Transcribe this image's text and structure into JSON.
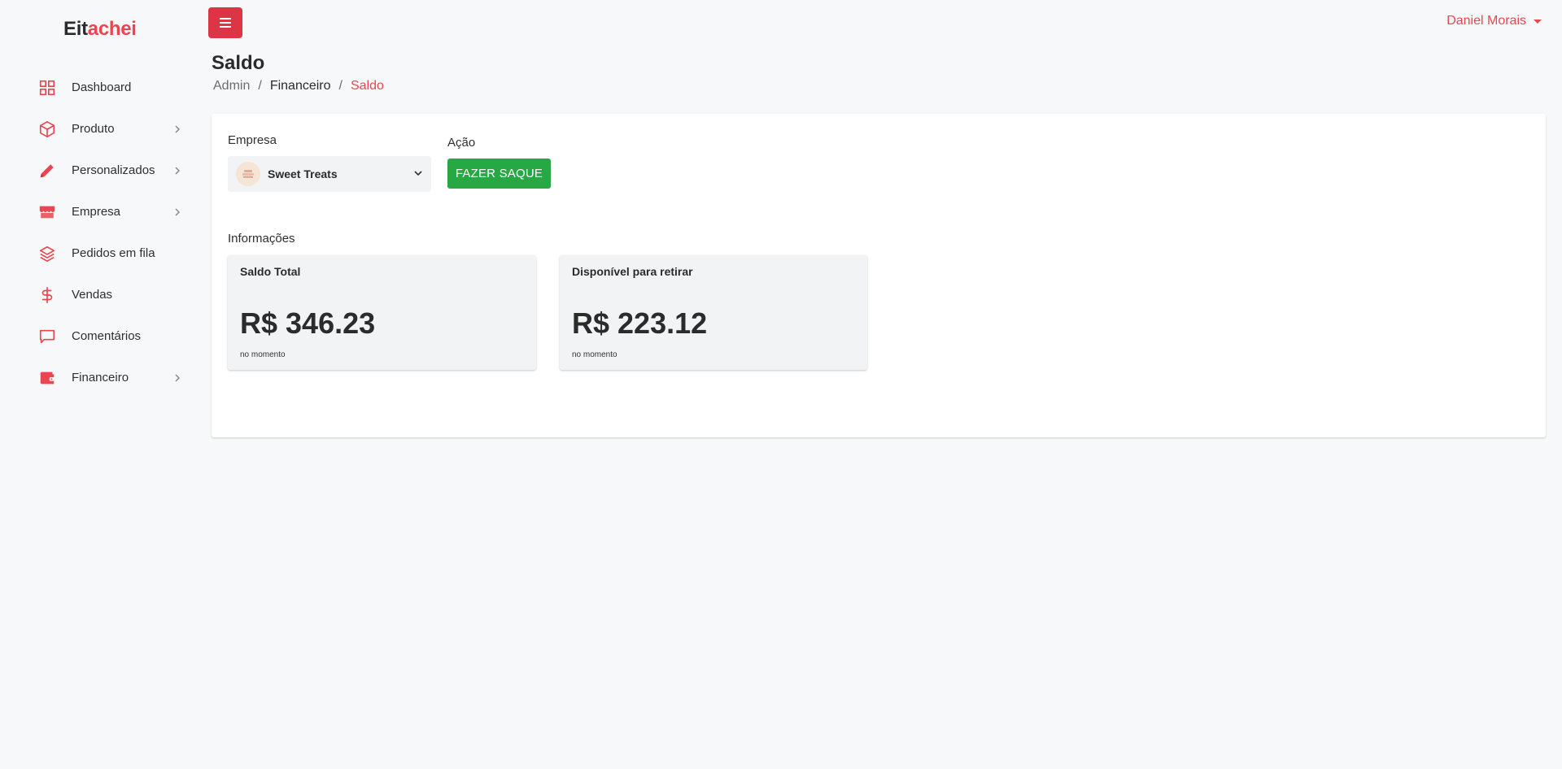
{
  "app": {
    "logo_part1": "Eit",
    "logo_part2": "achei",
    "accent_color": "#e8474f",
    "menu_button_color": "#dc3545",
    "success_color": "#28a745"
  },
  "user": {
    "name": "Daniel Morais"
  },
  "sidebar": {
    "items": [
      {
        "label": "Dashboard",
        "icon": "grid-icon",
        "has_submenu": false
      },
      {
        "label": "Produto",
        "icon": "box-icon",
        "has_submenu": true
      },
      {
        "label": "Personalizados",
        "icon": "pencil-icon",
        "has_submenu": true
      },
      {
        "label": "Empresa",
        "icon": "store-icon",
        "has_submenu": true
      },
      {
        "label": "Pedidos em fila",
        "icon": "layers-icon",
        "has_submenu": false
      },
      {
        "label": "Vendas",
        "icon": "dollar-icon",
        "has_submenu": false
      },
      {
        "label": "Comentários",
        "icon": "message-icon",
        "has_submenu": false
      },
      {
        "label": "Financeiro",
        "icon": "wallet-icon",
        "has_submenu": true
      }
    ]
  },
  "page": {
    "title": "Saldo",
    "breadcrumb": [
      "Admin",
      "Financeiro",
      "Saldo"
    ]
  },
  "form": {
    "empresa_label": "Empresa",
    "empresa_value": "Sweet Treats",
    "acao_label": "Ação",
    "saque_button": "FAZER SAQUE"
  },
  "info": {
    "section_label": "Informações",
    "cards": [
      {
        "title": "Saldo Total",
        "value": "R$ 346.23",
        "subtitle": "no momento"
      },
      {
        "title": "Disponível para retirar",
        "value": "R$ 223.12",
        "subtitle": "no momento"
      }
    ]
  }
}
